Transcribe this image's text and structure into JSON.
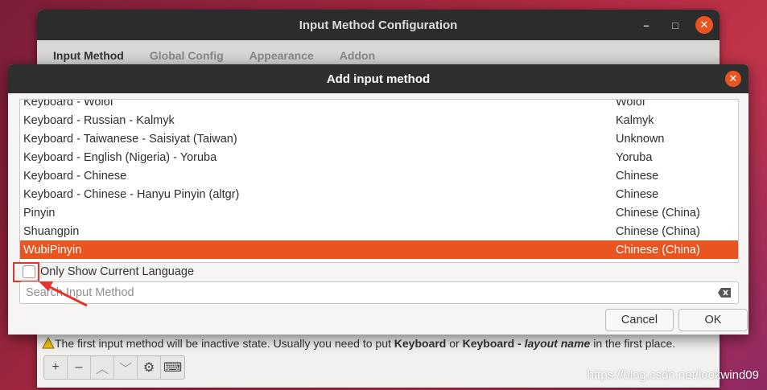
{
  "background_window": {
    "title": "Input Method Configuration",
    "controls": {
      "minimize": "–",
      "maximize": "□",
      "close": "✕"
    },
    "tabs": [
      {
        "label": "Input Method",
        "active": true
      },
      {
        "label": "Global Config",
        "active": false
      },
      {
        "label": "Appearance",
        "active": false
      },
      {
        "label": "Addon",
        "active": false
      }
    ],
    "note": {
      "part1": "The first input method will be inactive state. Usually you need to put ",
      "bold1": "Keyboard",
      "part2": " or ",
      "bold2": "Keyboard - ",
      "italic": "layout name",
      "part3": " in the first place."
    },
    "toolbar": [
      "+",
      "–",
      "︿",
      "﹀",
      "⚙",
      "⌨"
    ]
  },
  "dialog": {
    "title": "Add input method",
    "close": "✕",
    "list": [
      {
        "name": "Keyboard - Wolof",
        "lang": "Wolof"
      },
      {
        "name": "Keyboard - Russian - Kalmyk",
        "lang": "Kalmyk"
      },
      {
        "name": "Keyboard - Taiwanese - Saisiyat (Taiwan)",
        "lang": "Unknown"
      },
      {
        "name": "Keyboard - English (Nigeria) - Yoruba",
        "lang": "Yoruba"
      },
      {
        "name": "Keyboard - Chinese",
        "lang": "Chinese"
      },
      {
        "name": "Keyboard - Chinese - Hanyu Pinyin (altgr)",
        "lang": "Chinese"
      },
      {
        "name": "Pinyin",
        "lang": "Chinese (China)"
      },
      {
        "name": "Shuangpin",
        "lang": "Chinese (China)"
      },
      {
        "name": "WubiPinyin",
        "lang": "Chinese (China)"
      }
    ],
    "selected_index": 8,
    "only_current_language": {
      "label": "Only Show Current Language",
      "checked": false
    },
    "search": {
      "placeholder": "Search Input Method",
      "value": ""
    },
    "cancel_label": "Cancel",
    "ok_label": "OK"
  },
  "watermark": "https://blog.csdn.net/lookwind09",
  "colors": {
    "accent": "#e95420",
    "annotation": "#e3342f"
  }
}
